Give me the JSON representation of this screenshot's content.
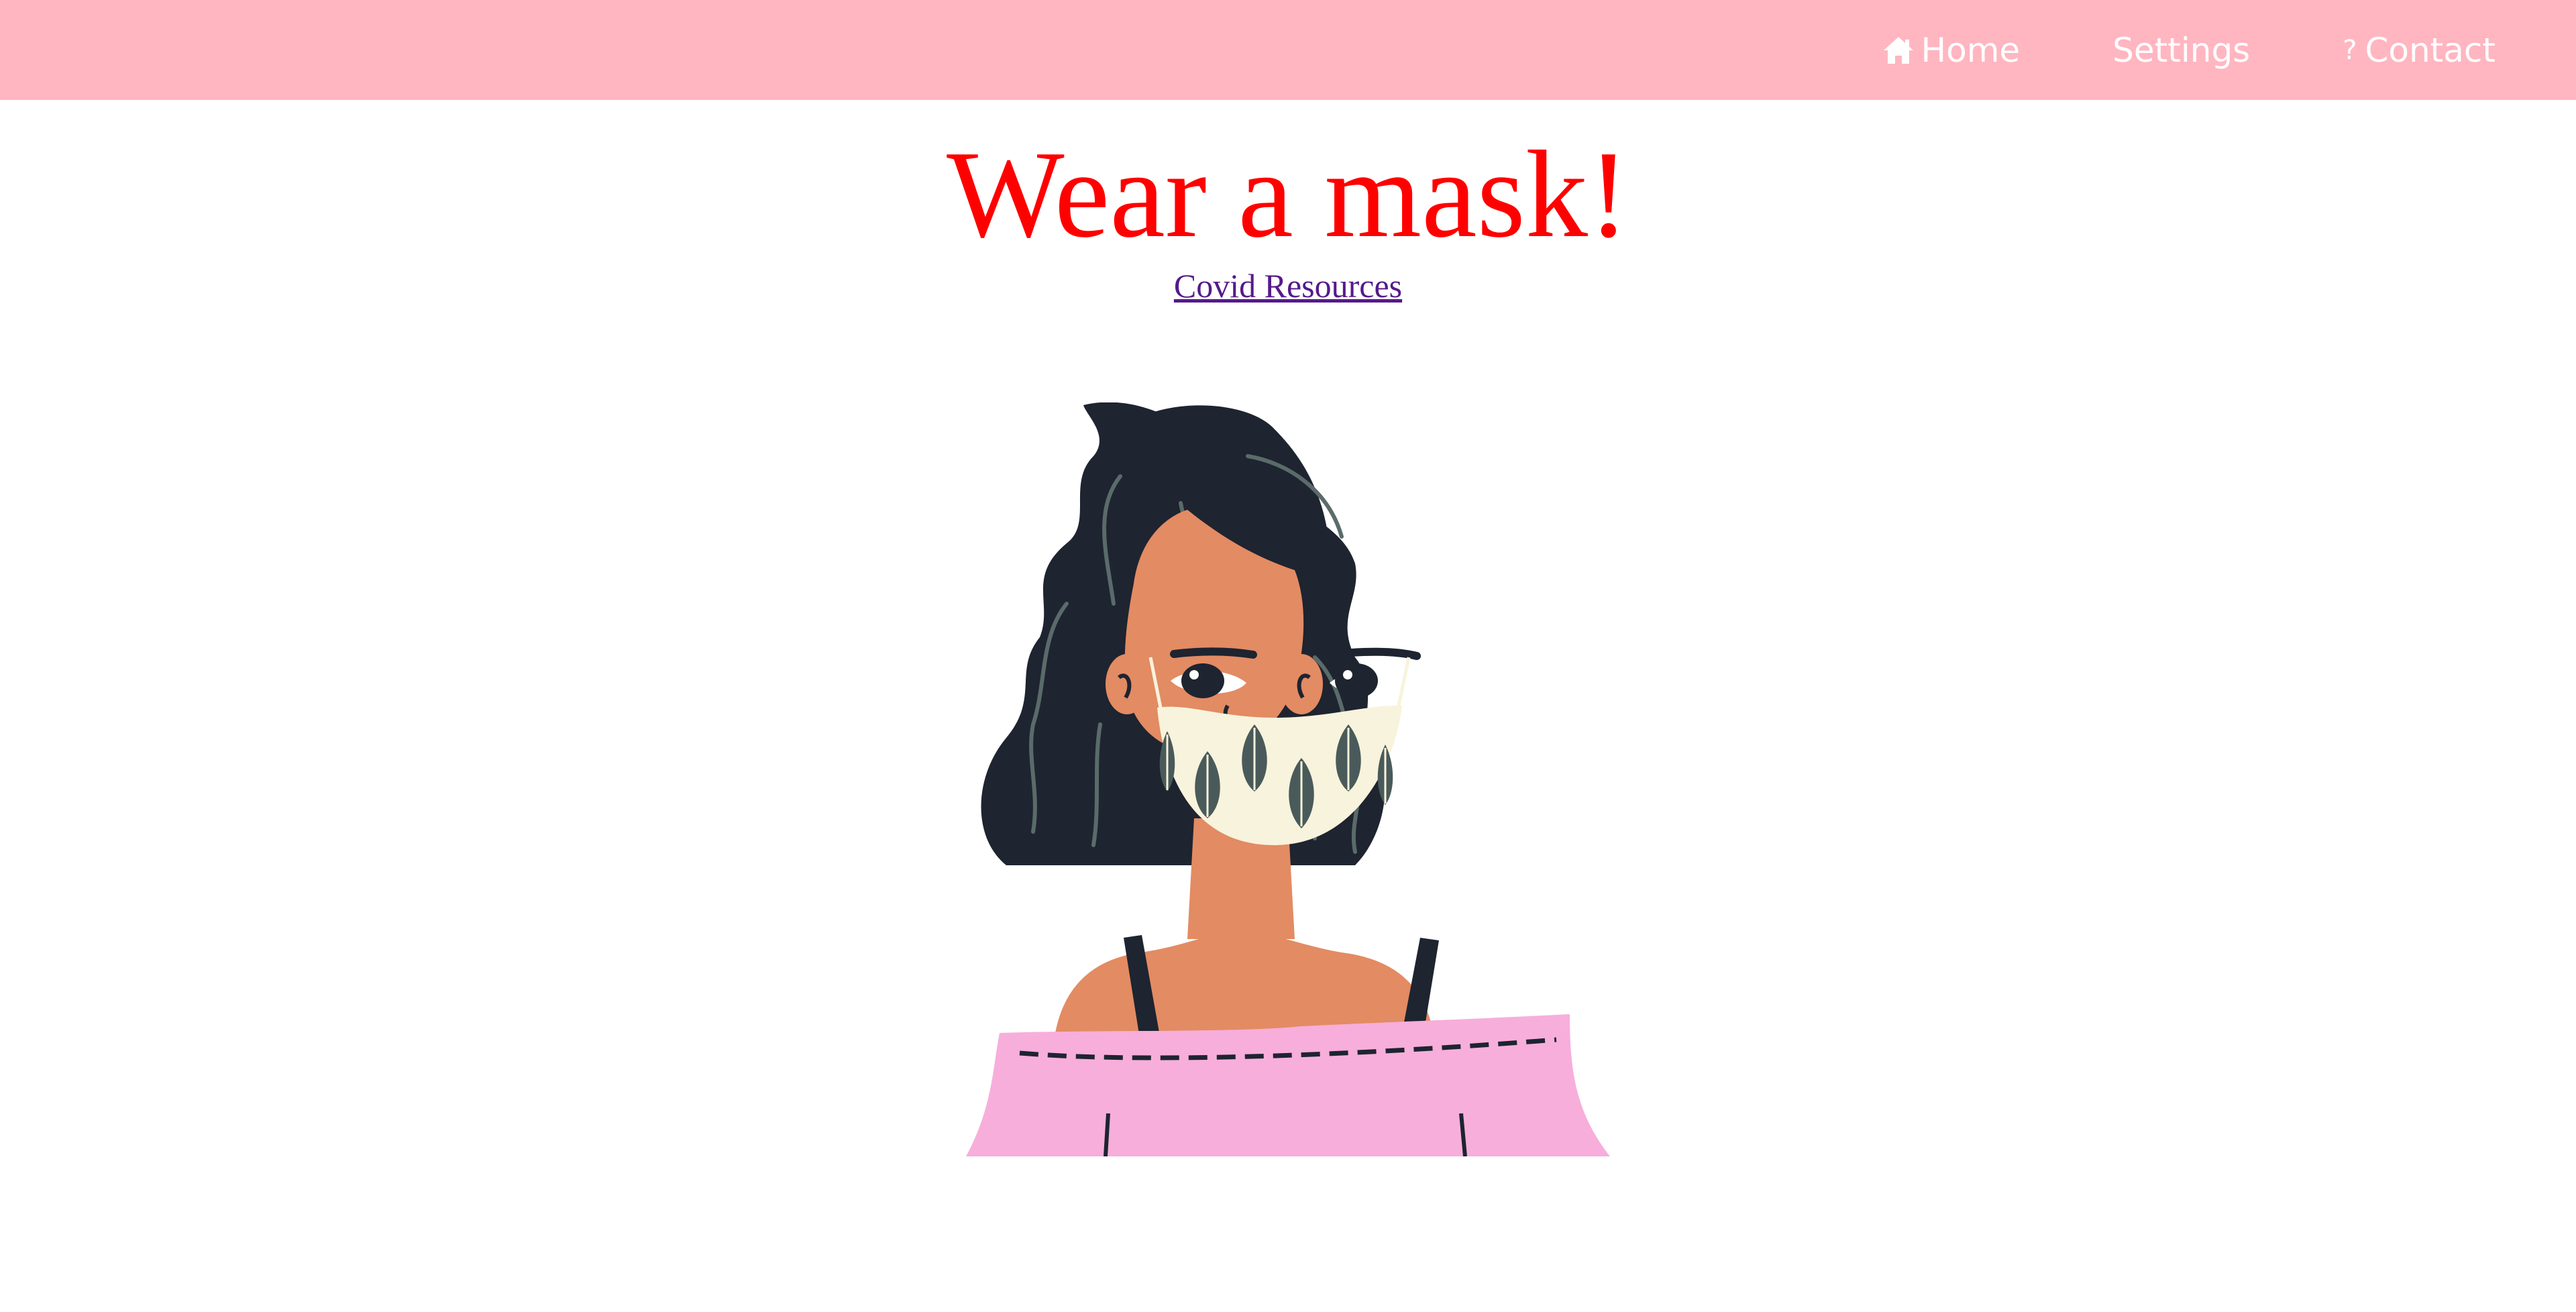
{
  "nav": {
    "items": [
      {
        "label": "Home",
        "icon": "home-icon"
      },
      {
        "label": "Settings",
        "icon": ""
      },
      {
        "label": "Contact",
        "icon": "question-icon",
        "glyph": "?"
      }
    ],
    "background": "#ffb6c1",
    "text_color": "#ffffff"
  },
  "page": {
    "title": "Wear a mask!",
    "title_color": "#ff0000",
    "resources_link": "Covid Resources",
    "link_color": "#551a8b"
  },
  "illustration": {
    "subject": "woman-wearing-patterned-face-mask",
    "colors": {
      "hair": "#1e2430",
      "hair_strands": "#5a6b6a",
      "skin": "#e38b63",
      "mask": "#f8f3dc",
      "mask_leaves": "#4a5a5a",
      "top": "#f7aedb",
      "straps": "#1e2430"
    }
  }
}
